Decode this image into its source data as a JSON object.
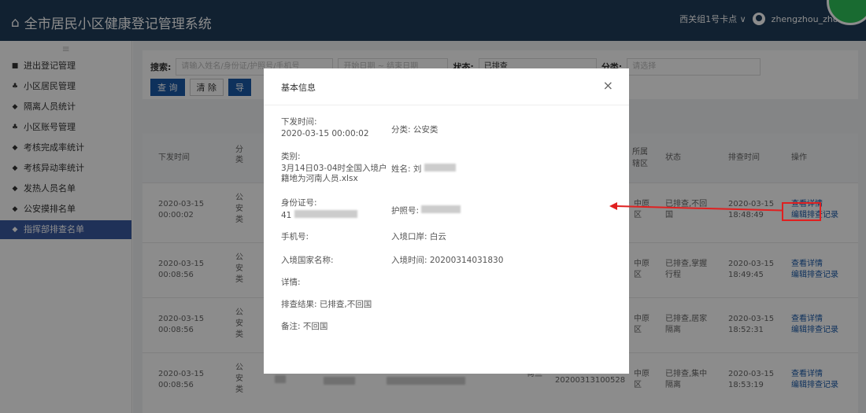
{
  "app": {
    "title": "全市居民小区健康登记管理系统",
    "station": "西关组1号卡点 ∨",
    "username": "zhengzhou_zhongyu"
  },
  "sidebar": {
    "toggle": "≡",
    "items": [
      {
        "icon": "lock-icon",
        "glyph": "■",
        "label": "进出登记管理"
      },
      {
        "icon": "users-icon",
        "glyph": "♣",
        "label": "小区居民管理"
      },
      {
        "icon": "arrow-icon",
        "glyph": "◆",
        "label": "隔离人员统计"
      },
      {
        "icon": "users-icon",
        "glyph": "♣",
        "label": "小区账号管理"
      },
      {
        "icon": "arrow-icon",
        "glyph": "◆",
        "label": "考核完成率统计"
      },
      {
        "icon": "arrow-icon",
        "glyph": "◆",
        "label": "考核异动率统计"
      },
      {
        "icon": "arrow-icon",
        "glyph": "◆",
        "label": "发热人员名单"
      },
      {
        "icon": "arrow-icon",
        "glyph": "◆",
        "label": "公安摸排名单"
      },
      {
        "icon": "arrow-icon",
        "glyph": "◆",
        "label": "指挥部排查名单",
        "active": true
      }
    ]
  },
  "search": {
    "label": "搜索:",
    "placeholder": "请输入姓名/身份证/护照号/手机号",
    "date_start": "开始日期",
    "date_sep": "~",
    "date_end": "结束日期",
    "status_label": "状态:",
    "status_value": "已排查",
    "category_label": "分类:",
    "category_placeholder": "请选择",
    "query_btn": "查 询",
    "clear_btn": "清 除",
    "export_btn": "导"
  },
  "table": {
    "headers": [
      "下发时间",
      "分类",
      "所属辖区",
      "状态",
      "排查时间",
      "操作"
    ],
    "rows": [
      {
        "date": "2020-03-15",
        "time": "00:00:02",
        "cat": "公安类",
        "area": "中原区",
        "status": "已排查,不回国",
        "check_date": "2020-03-15",
        "check_time": "18:48:49",
        "action1": "查看详情",
        "action2": "编辑排查记录"
      },
      {
        "date": "2020-03-15",
        "time": "00:08:56",
        "cat": "公安类",
        "area": "中原区",
        "status": "已排查,掌握行程",
        "check_date": "2020-03-15",
        "check_time": "18:49:45",
        "action1": "查看详情",
        "action2": "编辑排查记录"
      },
      {
        "date": "2020-03-15",
        "time": "00:08:56",
        "cat": "公安类",
        "area": "中原区",
        "status": "已排查,居家隔离",
        "check_date": "2020-03-15",
        "check_time": "18:52:31",
        "action1": "查看详情",
        "action2": "编辑排查记录"
      },
      {
        "date": "2020-03-15",
        "time": "00:08:56",
        "cat": "公安类",
        "country": "荷兰",
        "entry": "20200313100528",
        "area": "中原区",
        "status": "已排查,集中隔离",
        "check_date": "2020-03-15",
        "check_time": "18:53:19",
        "action1": "查看详情",
        "action2": "编辑排查记录"
      }
    ]
  },
  "modal": {
    "title": "基本信息",
    "close": "×",
    "issue_time_label": "下发时间:",
    "issue_time": "2020-03-15 00:00:02",
    "category": "分类: 公安类",
    "type_label": "类别:",
    "type_value": "3月14日03-04时全国入境户籍地为河南人员.xlsx",
    "name_label": "姓名: 刘",
    "id_label": "身份证号:",
    "id_prefix": "41",
    "passport_label": "护照号:",
    "phone_label": "手机号:",
    "port": "入境口岸: 白云",
    "country_label": "入境国家名称:",
    "entry_time": "入境时间: 20200314031830",
    "detail_label": "详情:",
    "result": "排查结果: 已排查,不回国",
    "remark": "备注: 不回国"
  }
}
